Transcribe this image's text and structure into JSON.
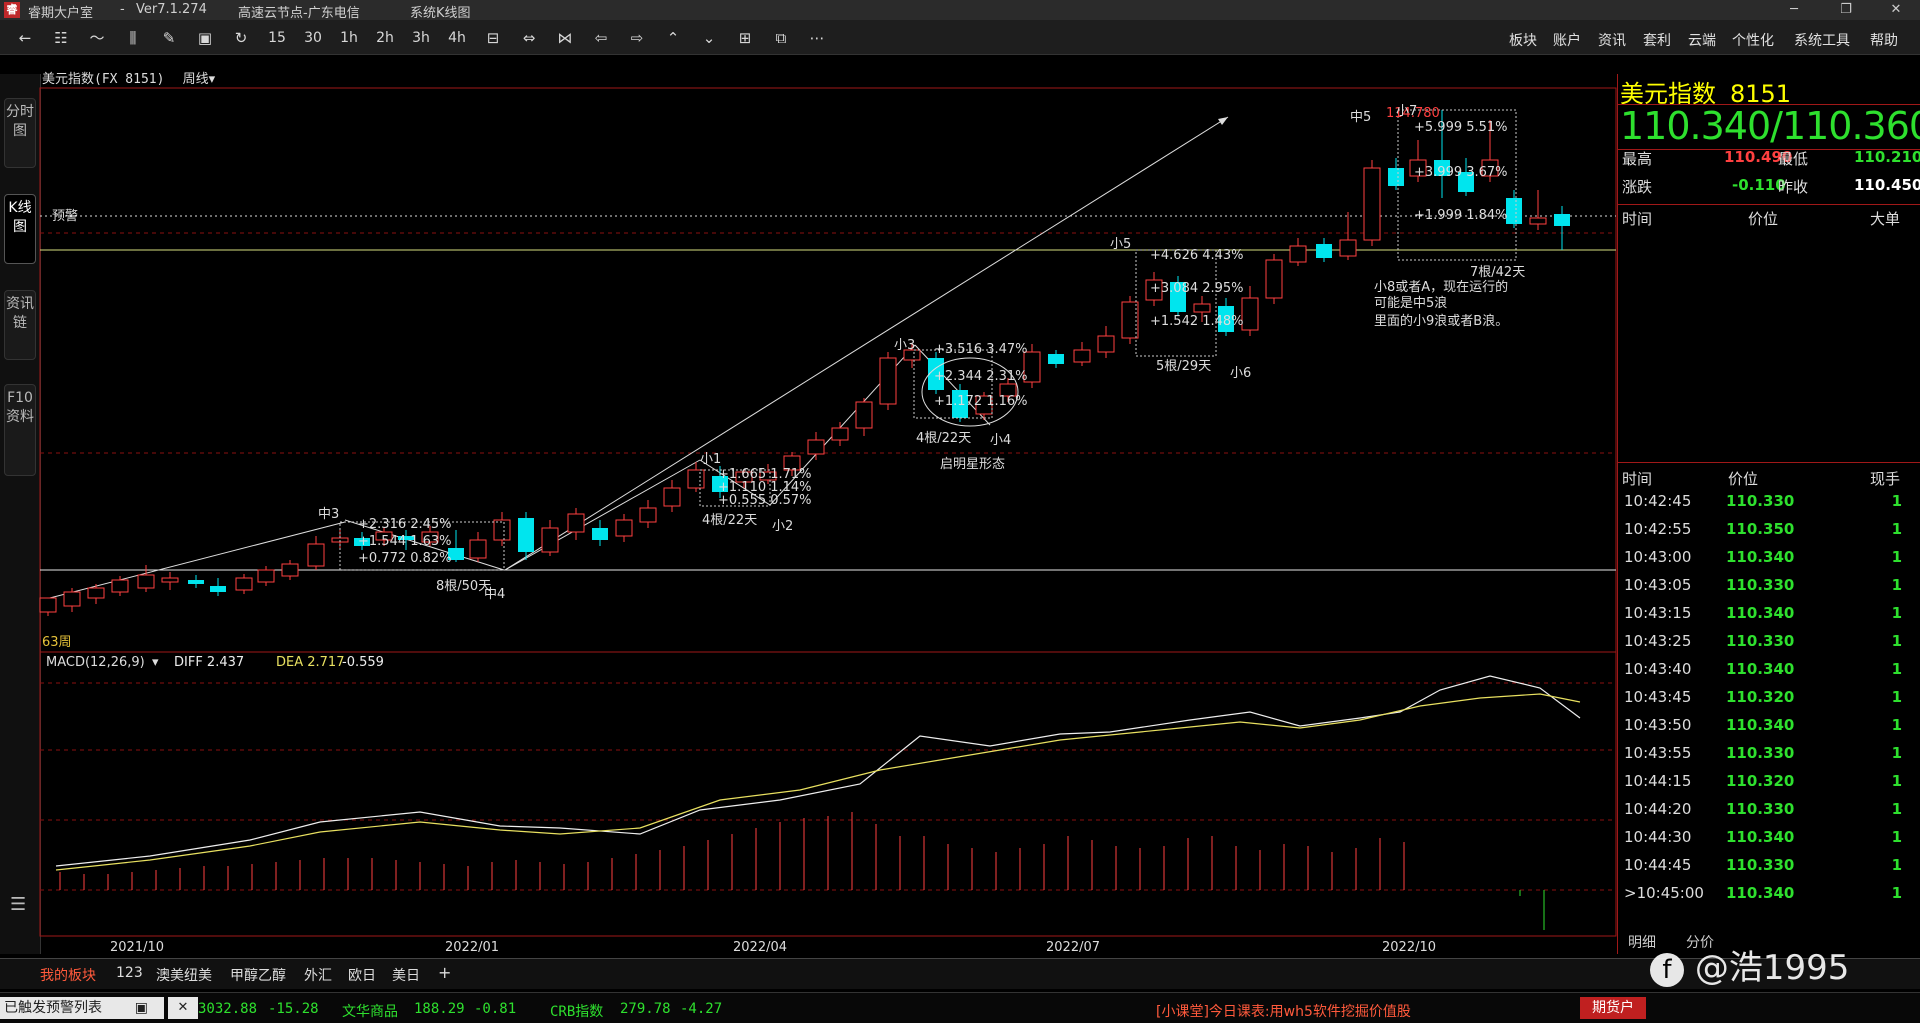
{
  "window": {
    "app_title": "睿期大户室",
    "version": "Ver7.1.274",
    "server": "高速云节点-广东电信",
    "module": "系统K线图"
  },
  "menus": [
    "板块",
    "账户",
    "资讯",
    "套利",
    "云端",
    "个性化",
    "系统工具",
    "帮助"
  ],
  "toolbar_buttons": [
    "15",
    "30",
    "1h",
    "2h",
    "3h",
    "4h"
  ],
  "chart_header": {
    "name": "美元指数(FX 8151)",
    "period": "周线"
  },
  "left_tabs": [
    "分时图",
    "K线图",
    "资讯链",
    "F10资料"
  ],
  "chart_labels": {
    "alert": "预警",
    "bars_label": "63周",
    "macd_title": "MACD(12,26,9)",
    "diff": "DIFF 2.437",
    "dea": "DEA 2.717",
    "macd": "-0.559",
    "xaxis": [
      "2021/10",
      "2022/01",
      "2022/04",
      "2022/07",
      "2022/10"
    ],
    "annotations": {
      "zhong3": "中3",
      "zhong4": "中4",
      "zhong5": "中5",
      "xiao1": "小1",
      "xiao2": "小2",
      "xiao3": "小3",
      "xiao4": "小4",
      "xiao5": "小5",
      "xiao6": "小6",
      "xiao7": "小7",
      "peak_price": "114.780",
      "z3_a": "+2.316  2.45%",
      "z3_b": "+1.544  1.63%",
      "z3_c": "+0.772  0.82%",
      "z3_n": "8根/50天",
      "x1_a": "+1.665  1.71%",
      "x1_b": "+1.110  1.14%",
      "x1_c": "+0.555  0.57%",
      "x1_n": "4根/22天",
      "x3_a": "+3.516  3.47%",
      "x3_b": "+2.344  2.31%",
      "x3_c": "+1.172  1.16%",
      "x3_n": "4根/22天",
      "star": "启明星形态",
      "x5_a": "+4.626  4.43%",
      "x5_b": "+3.084  2.95%",
      "x5_c": "+1.542  1.48%",
      "x5_n": "5根/29天",
      "x7_a": "+5.999  5.51%",
      "x7_b": "+3.999  3.67%",
      "x7_c": "+1.999  1.84%",
      "x7_n": "7根/42天",
      "note1": "小8或者A，现在运行的",
      "note2": "可能是中5浪",
      "note3": "里面的小9浪或者B浪。"
    }
  },
  "quote": {
    "name": "美元指数",
    "code": "8151",
    "bid_ask": "110.340/110.360",
    "high_label": "最高",
    "high": "110.490",
    "low_label": "最低",
    "low": "110.210",
    "chg_label": "涨跌",
    "chg": "-0.110",
    "prev_label": "昨收",
    "prev": "110.450",
    "book_headers": [
      "时间",
      "价位",
      "大单"
    ],
    "tick_headers": [
      "时间",
      "价位",
      "现手"
    ]
  },
  "ticks": [
    [
      "10:42:45",
      "110.330",
      "1"
    ],
    [
      "10:42:55",
      "110.350",
      "1"
    ],
    [
      "10:43:00",
      "110.340",
      "1"
    ],
    [
      "10:43:05",
      "110.330",
      "1"
    ],
    [
      "10:43:15",
      "110.340",
      "1"
    ],
    [
      "10:43:25",
      "110.330",
      "1"
    ],
    [
      "10:43:40",
      "110.340",
      "1"
    ],
    [
      "10:43:45",
      "110.320",
      "1"
    ],
    [
      "10:43:50",
      "110.340",
      "1"
    ],
    [
      "10:43:55",
      "110.330",
      "1"
    ],
    [
      "10:44:15",
      "110.320",
      "1"
    ],
    [
      "10:44:20",
      "110.330",
      "1"
    ],
    [
      "10:44:30",
      "110.340",
      "1"
    ],
    [
      "10:44:45",
      "110.330",
      "1"
    ],
    [
      "10:45:00",
      "110.340",
      "1"
    ]
  ],
  "detail_tabs": [
    "明细",
    "分价"
  ],
  "bottom_tabs": [
    "我的板块",
    "123",
    "澳美纽美",
    "甲醇乙醇",
    "外汇",
    "欧日",
    "美日",
    "+"
  ],
  "statusbar": {
    "alert_list": "已触发预警列表",
    "idx1": "3032.88",
    "idx1_chg": "-15.28",
    "idx2_name": "文华商品",
    "idx2": "188.29",
    "idx2_chg": "-0.81",
    "idx3_name": "CRB指数",
    "idx3": "279.78",
    "idx3_chg": "-4.27",
    "ad": "[小课堂]今日课表:用wh5软件挖掘价值股",
    "account": "期货户"
  },
  "watermark": "@浩1995",
  "colors": {
    "up": "#ff4040",
    "down": "#00e5ee",
    "frame": "#a01818",
    "price_green": "#2ee02e"
  }
}
